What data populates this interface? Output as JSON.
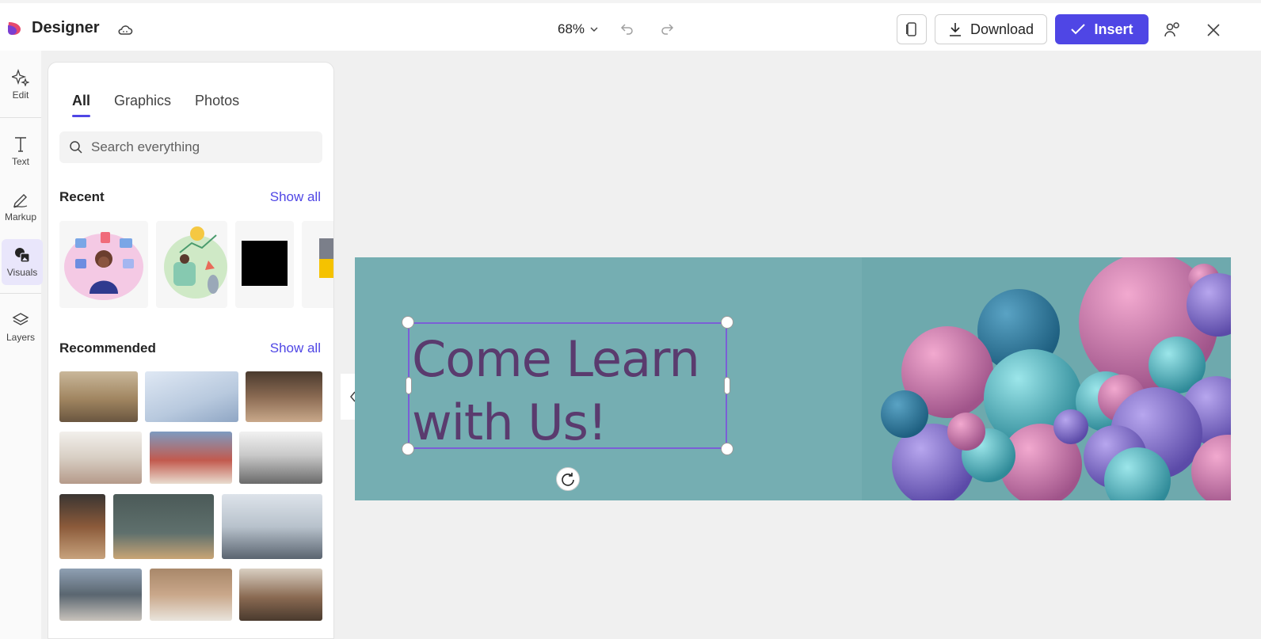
{
  "header": {
    "app_title": "Designer",
    "zoom_label": "68%",
    "download_label": "Download",
    "insert_label": "Insert"
  },
  "rail": {
    "items": [
      {
        "label": "Edit",
        "icon": "sparkle-icon"
      },
      {
        "label": "Text",
        "icon": "text-icon"
      },
      {
        "label": "Markup",
        "icon": "pen-icon"
      },
      {
        "label": "Visuals",
        "icon": "visuals-icon"
      },
      {
        "label": "Layers",
        "icon": "layers-icon"
      }
    ],
    "active": "Visuals"
  },
  "panel": {
    "tabs": [
      "All",
      "Graphics",
      "Photos"
    ],
    "active_tab": "All",
    "search_placeholder": "Search everything",
    "recent_title": "Recent",
    "recommended_title": "Recommended",
    "show_all": "Show all"
  },
  "canvas": {
    "text_line1": "Come Learn",
    "text_line2": "with Us!"
  },
  "colors": {
    "accent": "#4f46e5",
    "banner_bg": "#6ea9ad",
    "banner_text": "#5a3b6e"
  }
}
